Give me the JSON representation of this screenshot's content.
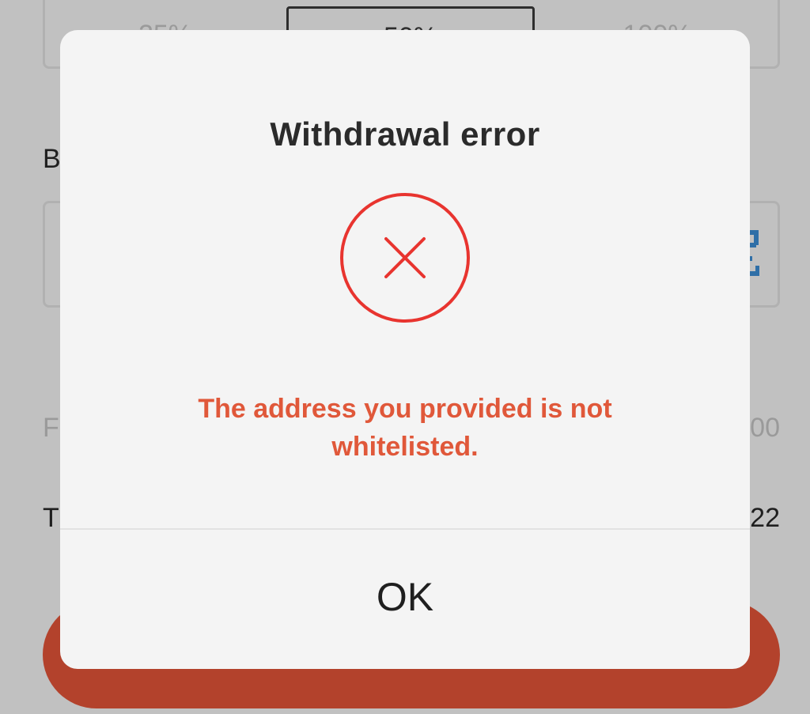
{
  "background": {
    "percent_options": [
      "25%",
      "50%",
      "100%"
    ],
    "selected_percent": "50%",
    "labels": {
      "b": "B",
      "f": "F",
      "t": "T"
    },
    "values": {
      "fee_partial": "00",
      "total_partial": "22"
    },
    "icons": {
      "scan": "scan-qr-icon"
    },
    "colors": {
      "submit_button": "#b3422c",
      "scan_icon": "#2f6fa7"
    }
  },
  "dialog": {
    "title": "Withdrawal error",
    "message": "The address you provided is not whitelisted.",
    "ok_label": "OK",
    "icon": "error-x-circle-icon",
    "colors": {
      "error_red": "#e8342f",
      "message": "#e0583a"
    }
  }
}
